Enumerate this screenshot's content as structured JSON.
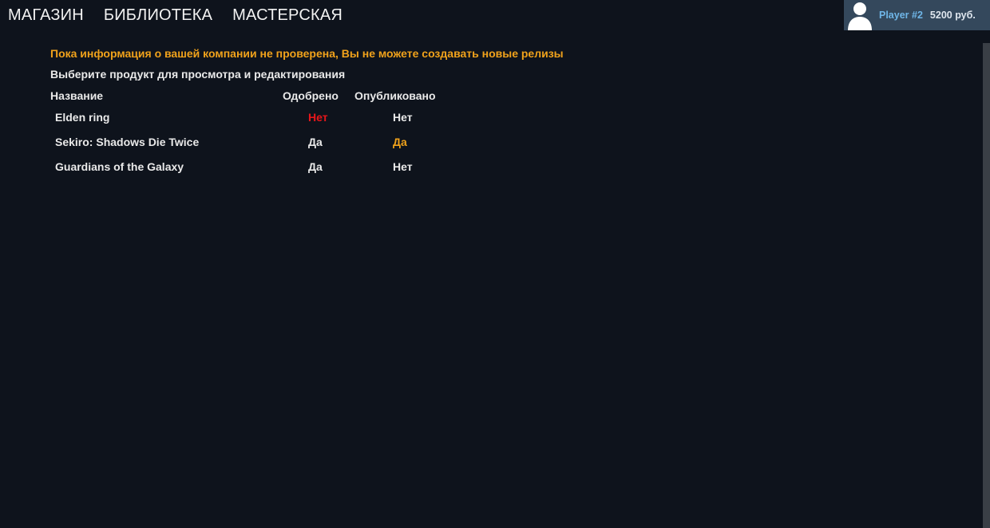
{
  "nav": {
    "items": [
      {
        "label": "МАГАЗИН"
      },
      {
        "label": "БИБЛИОТЕКА"
      },
      {
        "label": "МАСТЕРСКАЯ"
      }
    ]
  },
  "user": {
    "avatar_icon": "user-silhouette-icon",
    "name": "Player #2",
    "balance": "5200 руб."
  },
  "main": {
    "warning": "Пока информация о вашей компании не проверена, Вы не можете создавать новые релизы",
    "instruction": "Выберите продукт для просмотра и редактирования",
    "columns": {
      "name": "Название",
      "approved": "Одобрено",
      "published": "Опубликовано"
    },
    "products": [
      {
        "name": "Elden ring",
        "approved": "Нет",
        "published": "Нет"
      },
      {
        "name": "Sekiro: Shadows Die Twice",
        "approved": "Да",
        "published": "Да"
      },
      {
        "name": "Guardians of the Galaxy",
        "approved": "Да",
        "published": "Нет"
      }
    ]
  },
  "colors": {
    "background": "#0e131c",
    "warning": "#f0a21b",
    "negative": "#e8161a",
    "user_panel": "#34485c",
    "user_name": "#6fb6e8"
  }
}
